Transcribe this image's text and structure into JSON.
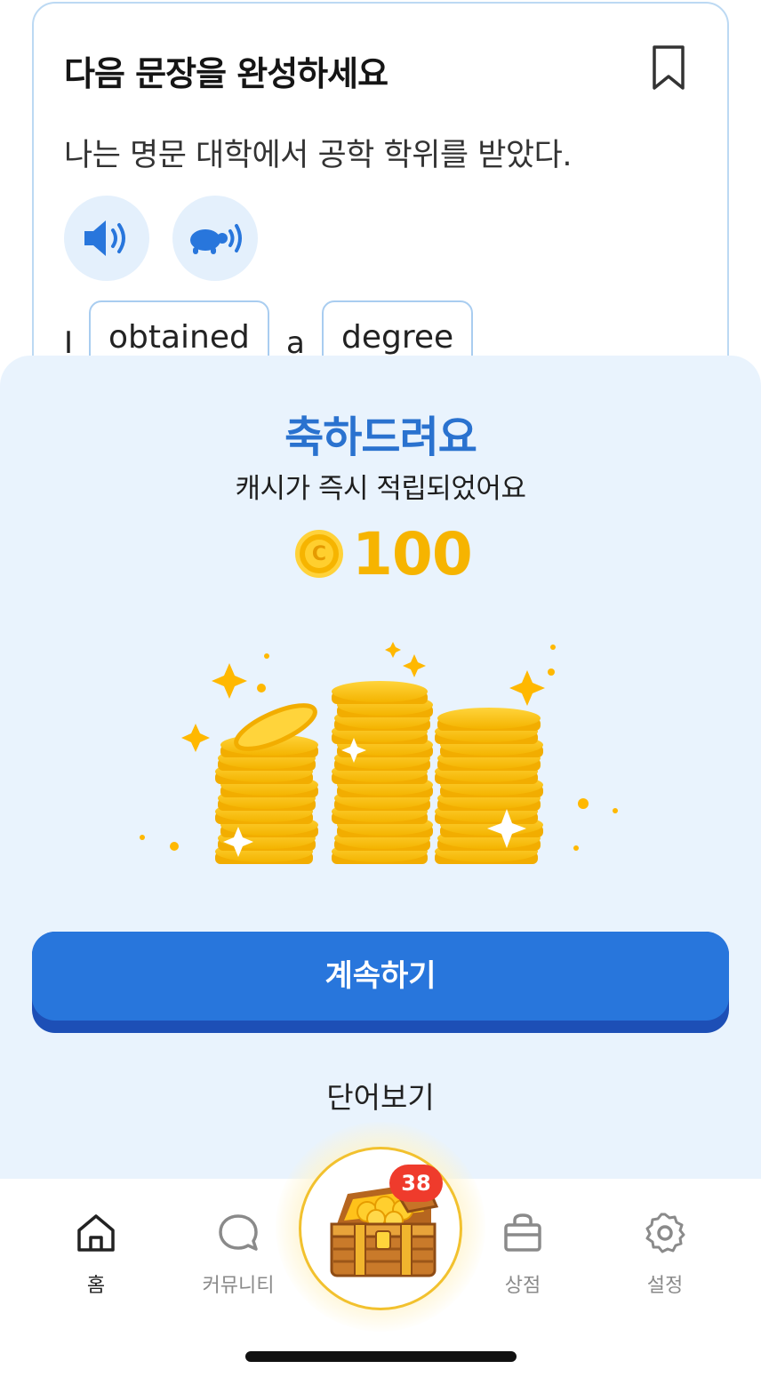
{
  "question": {
    "title": "다음 문장을 완성하세요",
    "sentence": "나는 명문 대학에서 공학 학위를 받았다.",
    "answer_words": [
      "I",
      "obtained",
      "a",
      "degree"
    ]
  },
  "reward_sheet": {
    "title": "축하드려요",
    "subtitle": "캐시가 즉시 적립되었어요",
    "coin_symbol": "C",
    "amount": "100",
    "continue_label": "계속하기",
    "words_link": "단어보기"
  },
  "tabbar": {
    "home": "홈",
    "community": "커뮤니티",
    "shop": "상점",
    "settings": "설정",
    "chest_badge": "38"
  },
  "colors": {
    "accent": "#2876dc",
    "coin": "#f6b400",
    "badge": "#ef3b2c",
    "sheet_bg": "#e9f3fd"
  },
  "icons": [
    "bookmark-icon",
    "speaker-icon",
    "turtle-speaker-icon",
    "home-icon",
    "chat-bubble-icon",
    "treasure-chest-icon",
    "shopping-bag-icon",
    "gear-icon"
  ]
}
